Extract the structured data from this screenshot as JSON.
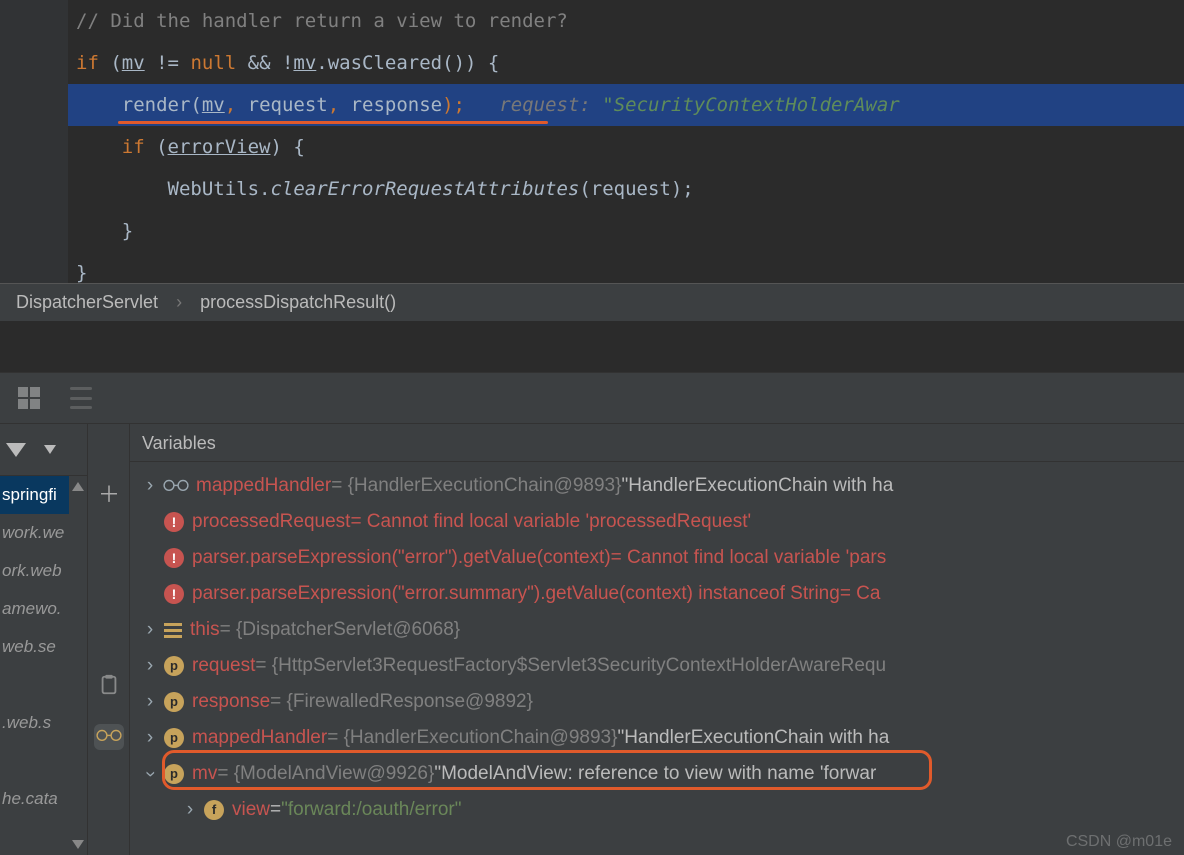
{
  "editor": {
    "comment": "// Did the handler return a view to render?",
    "line2": {
      "kw_if": "if",
      "mv": "mv",
      "ne": " != ",
      "null": "null",
      "and": " && !",
      "mv2": "mv",
      "call": ".wasCleared()) {"
    },
    "line3": {
      "render": "render(",
      "mv": "mv",
      "sep1": ", ",
      "req": "request",
      "sep2": ", ",
      "resp": "response",
      "end": ");",
      "hint_label": "request: ",
      "hint_value": "\"SecurityContextHolderAwar"
    },
    "line4": {
      "kw_if": "if",
      "open": " (",
      "errorView": "errorView",
      "close": ") {"
    },
    "line5": {
      "cls": "WebUtils.",
      "method": "clearErrorRequestAttributes",
      "args": "(request);"
    },
    "brace1": "}",
    "brace2": "}"
  },
  "breadcrumb": {
    "a": "DispatcherServlet",
    "sep": "›",
    "b": "processDispatchResult()"
  },
  "variables_header": "Variables",
  "frames": {
    "items": [
      "springfi",
      "work.we",
      "ork.web",
      "amewo.",
      "web.se",
      "",
      ".web.s",
      "",
      "he.cata"
    ]
  },
  "vars": {
    "row0": {
      "name": "mappedHandler",
      "val_grey": " = {HandlerExecutionChain@9893} ",
      "val_white": "\"HandlerExecutionChain with ha"
    },
    "row1": {
      "name": "processedRequest",
      "val_red": " = Cannot find local variable 'processedRequest'"
    },
    "row2": {
      "name": "parser.parseExpression(\"error\").getValue(context)",
      "val_red": " = Cannot find local variable 'pars"
    },
    "row3": {
      "name": "parser.parseExpression(\"error.summary\").getValue(context) instanceof String",
      "val_red": " = Ca"
    },
    "row4": {
      "name": "this",
      "val_grey": " = {DispatcherServlet@6068}"
    },
    "row5": {
      "name": "request",
      "val_grey": " = {HttpServlet3RequestFactory$Servlet3SecurityContextHolderAwareRequ"
    },
    "row6": {
      "name": "response",
      "val_grey": " = {FirewalledResponse@9892}"
    },
    "row7": {
      "name": "mappedHandler",
      "val_grey": " = {HandlerExecutionChain@9893} ",
      "val_white": "\"HandlerExecutionChain with ha"
    },
    "row8": {
      "name": "mv",
      "val_grey": " = {ModelAndView@9926} ",
      "val_white": "\"ModelAndView: reference to view with name 'forwar"
    },
    "row9": {
      "name": "view",
      "eq": " = ",
      "val_green": "\"forward:/oauth/error\""
    }
  },
  "watermark": "CSDN @m01e"
}
